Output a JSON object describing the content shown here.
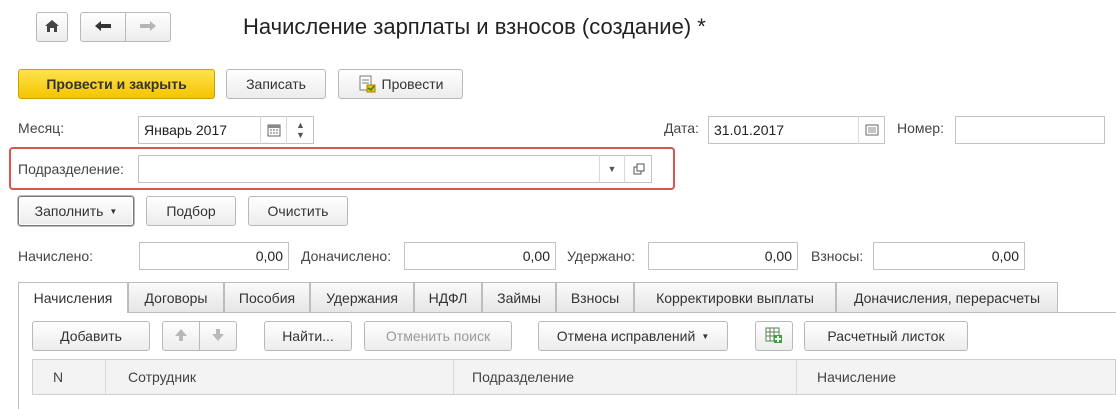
{
  "window": {
    "title": "Начисление зарплаты и взносов (создание) *"
  },
  "toolbar": {
    "post_close": "Провести и закрыть",
    "save": "Записать",
    "post": "Провести"
  },
  "form": {
    "month_label": "Месяц:",
    "month_value": "Январь 2017",
    "date_label": "Дата:",
    "date_value": "31.01.2017",
    "number_label": "Номер:",
    "number_value": "",
    "division_label": "Подразделение:",
    "division_value": ""
  },
  "actions": {
    "fill": "Заполнить",
    "pick": "Подбор",
    "clear": "Очистить"
  },
  "totals": {
    "accrued_label": "Начислено:",
    "accrued_value": "0,00",
    "additional_label": "Доначислено:",
    "additional_value": "0,00",
    "withheld_label": "Удержано:",
    "withheld_value": "0,00",
    "contributions_label": "Взносы:",
    "contributions_value": "0,00"
  },
  "tabs": [
    "Начисления",
    "Договоры",
    "Пособия",
    "Удержания",
    "НДФЛ",
    "Займы",
    "Взносы",
    "Корректировки выплаты",
    "Доначисления, перерасчеты"
  ],
  "table_toolbar": {
    "add": "Добавить",
    "find": "Найти...",
    "cancel_search": "Отменить поиск",
    "cancel_corrections": "Отмена исправлений",
    "payslip": "Расчетный листок"
  },
  "table": {
    "columns": [
      "N",
      "Сотрудник",
      "Подразделение",
      "Начисление"
    ]
  },
  "colors": {
    "primary_button": "#f4c400",
    "highlight_box": "#d9534f"
  }
}
